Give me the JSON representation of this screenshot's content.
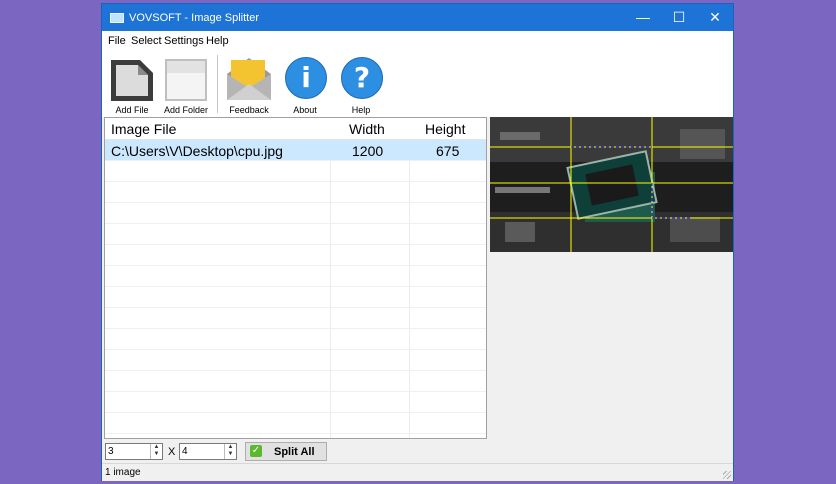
{
  "window": {
    "title": "VOVSOFT - Image Splitter",
    "controls": {
      "minimize": "—",
      "maximize": "☐",
      "close": "✕"
    }
  },
  "menu": [
    "File",
    "Select",
    "Settings",
    "Help"
  ],
  "toolbar": {
    "add_file": "Add File",
    "add_folder": "Add Folder",
    "feedback": "Feedback",
    "about": "About",
    "about_glyph": "i",
    "help": "Help",
    "help_glyph": "?"
  },
  "table": {
    "columns": [
      "Image File",
      "Width",
      "Height"
    ],
    "rows": [
      [
        "C:\\Users\\V\\Desktop\\cpu.jpg",
        "1200",
        "675"
      ]
    ],
    "selected_row": 0
  },
  "controls": {
    "rows_value": "3",
    "x_label": "X",
    "cols_value": "4",
    "split_label": "Split All",
    "split_icon": "✓"
  },
  "status": {
    "text": "1 image"
  },
  "colors": {
    "accent": "#1e73d6",
    "background": "#7b67c1",
    "selection": "#cce8ff",
    "grid_lines": "#ffff00",
    "split_icon": "#5cb82e"
  }
}
